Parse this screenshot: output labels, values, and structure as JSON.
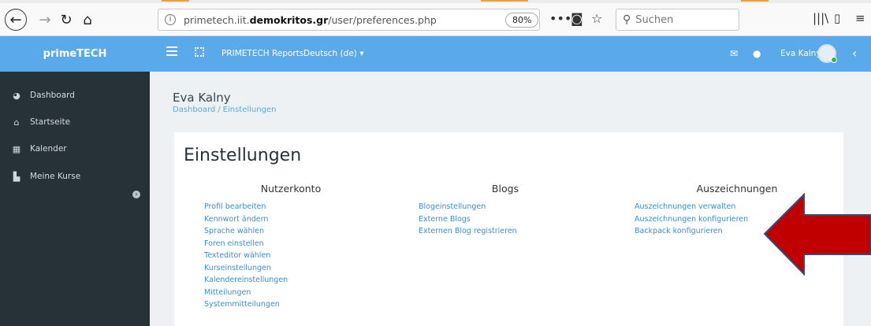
{
  "browser": {
    "url_prefix": "primetech.iit.",
    "url_domain": "demokritos.gr",
    "url_path": "/user/preferences.php",
    "zoom": "80%",
    "search_placeholder": "Suchen"
  },
  "appbar": {
    "brand": "primeTECH",
    "reports": "PRIMETECH Reports",
    "language": "Deutsch (de) ▾",
    "user_name": "Eva Kalny"
  },
  "sidebar": {
    "items": [
      {
        "label": "Dashboard",
        "icon": "dashboard-icon"
      },
      {
        "label": "Startseite",
        "icon": "home-icon"
      },
      {
        "label": "Kalender",
        "icon": "calendar-icon"
      },
      {
        "label": "Meine Kurse",
        "icon": "courses-icon"
      }
    ]
  },
  "header": {
    "title": "Eva Kalny",
    "breadcrumb": [
      "Dashboard",
      "Einstellungen"
    ]
  },
  "card": {
    "title": "Einstellungen",
    "columns": [
      {
        "heading": "Nutzerkonto",
        "links": [
          "Profil bearbeiten",
          "Kennwort ändern",
          "Sprache wählen",
          "Foren einstellen",
          "Texteditor wählen",
          "Kurseinstellungen",
          "Kalendereinstellungen",
          "Mitteilungen",
          "Systemmitteilungen"
        ]
      },
      {
        "heading": "Blogs",
        "links": [
          "Blogeinstellungen",
          "Externe Blogs",
          "Externen Blog registrieren"
        ]
      },
      {
        "heading": "Auszeichnungen",
        "links": [
          "Auszeichnungen verwalten",
          "Auszeichnungen konfigurieren",
          "Backpack konfigurieren"
        ]
      }
    ]
  },
  "colors": {
    "appbar": "#5aa9ea",
    "sidebar": "#263238",
    "link": "#3a8ed6",
    "arrow_fill": "#c00000",
    "arrow_stroke": "#2e4d7b"
  }
}
